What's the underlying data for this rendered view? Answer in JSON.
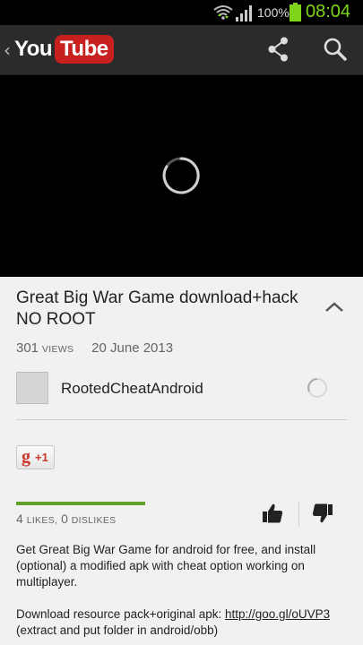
{
  "status_bar": {
    "battery_percent": "100%",
    "time": "08:04",
    "icons": [
      "wifi-icon",
      "signal-icon",
      "battery-icon"
    ],
    "time_color": "#7fd41c"
  },
  "app_bar": {
    "logo_you": "You",
    "logo_tube": "Tube",
    "brand_color": "#c8201e",
    "icons": [
      "back-chevron-icon",
      "share-icon",
      "search-icon"
    ]
  },
  "video": {
    "state": "loading",
    "icon": "loading-spinner-icon"
  },
  "video_info": {
    "title": "Great Big War Game download+hack NO ROOT",
    "views_count": "301",
    "views_label": "views",
    "date": "20 June 2013",
    "channel_name": "RootedCheatAndroid",
    "gplus_g": "g",
    "gplus_label": "+1",
    "likes_count": "4",
    "likes_label": "likes,",
    "dislikes_count": "0",
    "dislikes_label": "dislikes",
    "like_ratio": 1.0,
    "like_color": "#62a02a",
    "description_p1": "Get Great Big War Game for android for free, and install (optional) a modified apk with cheat option working on multiplayer.",
    "description_p2_prefix": "Download resource pack+original apk: ",
    "description_p2_link": "http://goo.gl/oUVP3",
    "description_p2_suffix": " (extract and put folder in android/obb)"
  }
}
